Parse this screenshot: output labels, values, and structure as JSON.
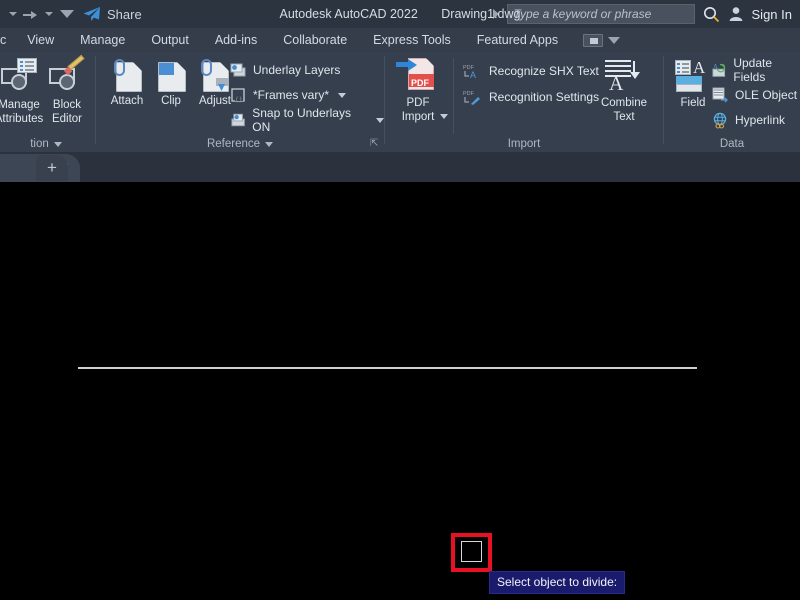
{
  "titlebar": {
    "share_label": "Share",
    "app_title": "Autodesk AutoCAD 2022",
    "document_name": "Drawing1.dwg",
    "search_placeholder": "Type a keyword or phrase",
    "signin_label": "Sign In",
    "icons": {
      "redo": "redo-arrow-icon",
      "share": "share-paper-plane-icon",
      "search": "search-icon",
      "account": "user-account-icon"
    }
  },
  "ribbon_tabs": [
    {
      "label": "c"
    },
    {
      "label": "View"
    },
    {
      "label": "Manage"
    },
    {
      "label": "Output"
    },
    {
      "label": "Add-ins"
    },
    {
      "label": "Collaborate"
    },
    {
      "label": "Express Tools"
    },
    {
      "label": "Featured Apps"
    }
  ],
  "ribbon_panels": [
    {
      "title": "tion",
      "buttons": [
        {
          "label": "Manage\nAttributes"
        },
        {
          "label": "Block\nEditor"
        }
      ]
    },
    {
      "title": "Reference",
      "buttons": [
        {
          "label": "Attach"
        },
        {
          "label": "Clip"
        },
        {
          "label": "Adjust"
        }
      ],
      "items": [
        {
          "label": "Underlay Layers"
        },
        {
          "label": "*Frames vary*"
        },
        {
          "label": "Snap to Underlays ON"
        }
      ]
    },
    {
      "title": "Import",
      "buttons": [
        {
          "label": "PDF\nImport"
        },
        {
          "label": "Combine\nText"
        }
      ],
      "items": [
        {
          "label": "Recognize SHX Text"
        },
        {
          "label": "Recognition Settings"
        }
      ]
    },
    {
      "title": "Data",
      "buttons": [
        {
          "label": "Field"
        }
      ],
      "items": [
        {
          "label": "Update Fields"
        },
        {
          "label": "OLE Object"
        },
        {
          "label": "Hyperlink"
        }
      ]
    }
  ],
  "tabbar": {
    "close_label": "✕",
    "new_tab_label": "+"
  },
  "canvas": {
    "prompt_tooltip": "Select object to divide:",
    "colors": {
      "background": "#000000",
      "line": "#cfcfcf",
      "pick_highlight": "#e81123",
      "tooltip_bg": "#1b1b6e",
      "tooltip_text": "#f2f2f8"
    }
  }
}
